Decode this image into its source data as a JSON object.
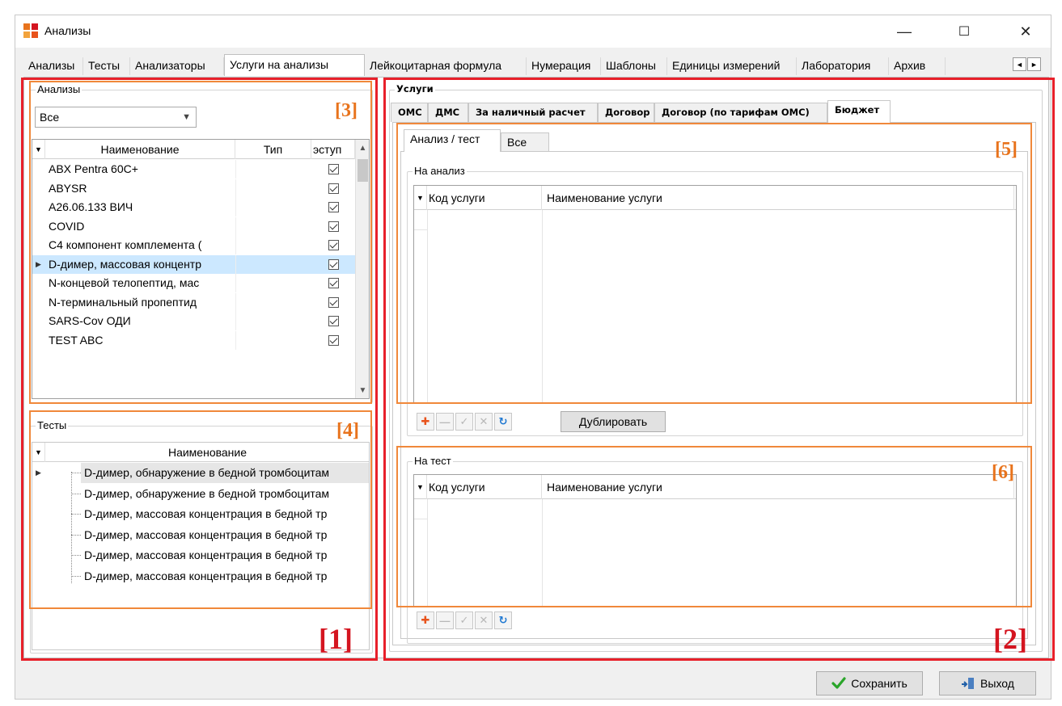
{
  "window": {
    "title": "Анализы",
    "minimize": "—",
    "maximize": "☐",
    "close": "✕"
  },
  "main_tabs": [
    {
      "label": "Анализы",
      "active": false
    },
    {
      "label": "Тесты",
      "active": false
    },
    {
      "label": "Анализаторы",
      "active": false
    },
    {
      "label": "Услуги на анализы",
      "active": true
    },
    {
      "label": "Лейкоцитарная формула",
      "active": false
    },
    {
      "label": "Нумерация",
      "active": false
    },
    {
      "label": "Шаблоны",
      "active": false
    },
    {
      "label": "Единицы измерений",
      "active": false
    },
    {
      "label": "Лаборатория",
      "active": false
    },
    {
      "label": "Архив",
      "active": false
    }
  ],
  "tab_scroll": {
    "left": "◄",
    "right": "►"
  },
  "analyses_panel": {
    "legend": "Анализы",
    "filter_value": "Все",
    "columns": [
      "Наименование",
      "Тип",
      "эступ"
    ],
    "rows": [
      {
        "name": "ABX Pentra 60C+",
        "type": "",
        "checked": true,
        "selected": false
      },
      {
        "name": "ABYSR",
        "type": "",
        "checked": true,
        "selected": false
      },
      {
        "name": "A26.06.133 ВИЧ",
        "type": "",
        "checked": true,
        "selected": false
      },
      {
        "name": "COVID",
        "type": "",
        "checked": true,
        "selected": false
      },
      {
        "name": "C4 компонент комплемента (",
        "type": "",
        "checked": true,
        "selected": false
      },
      {
        "name": "D-димер, массовая концентр",
        "type": "",
        "checked": true,
        "selected": true
      },
      {
        "name": "N-концевой телопептид, мас",
        "type": "",
        "checked": true,
        "selected": false
      },
      {
        "name": "N-терминальный пропептид",
        "type": "",
        "checked": true,
        "selected": false
      },
      {
        "name": "SARS-Cov ОДИ",
        "type": "",
        "checked": true,
        "selected": false
      },
      {
        "name": "TEST ABC",
        "type": "",
        "checked": true,
        "selected": false
      }
    ]
  },
  "tests_panel": {
    "legend": "Тесты",
    "column": "Наименование",
    "rows": [
      "D-димер, обнаружение в бедной тромбоцитам",
      "D-димер, обнаружение в бедной тромбоцитам",
      "D-димер, массовая концентрация в бедной тр",
      "D-димер, массовая концентрация в бедной тр",
      "D-димер, массовая концентрация в бедной тр",
      "D-димер, массовая концентрация в бедной тр"
    ]
  },
  "services_panel": {
    "legend": "Услуги",
    "payment_tabs": [
      {
        "label": "ОМС",
        "active": false
      },
      {
        "label": "ДМС",
        "active": false
      },
      {
        "label": "За наличный расчет",
        "active": false
      },
      {
        "label": "Договор",
        "active": false
      },
      {
        "label": "Договор (по тарифам ОМС)",
        "active": false
      },
      {
        "label": "Бюджет",
        "active": true
      }
    ],
    "inner_tabs": [
      {
        "label": "Анализ / тест",
        "active": true
      },
      {
        "label": "Все",
        "active": false
      }
    ],
    "on_analysis": {
      "legend": "На анализ",
      "columns": [
        "Код услуги",
        "Наименование услуги"
      ],
      "duplicate_button": "Дублировать"
    },
    "on_test": {
      "legend": "На тест",
      "columns": [
        "Код услуги",
        "Наименование услуги"
      ]
    }
  },
  "toolbar_icons": {
    "add": "✚",
    "remove": "—",
    "apply": "✓",
    "cancel": "✕",
    "refresh": "↻"
  },
  "footer": {
    "save_label": "Сохранить",
    "exit_label": "Выход"
  },
  "annotations": {
    "m1": "[1]",
    "m2": "[2]",
    "m3": "[3]",
    "m4": "[4]",
    "m5": "[5]",
    "m6": "[6]"
  },
  "colors": {
    "red_frame": "#e8202a",
    "orange_frame": "#f0883a",
    "selection": "#cce8ff",
    "save_check": "#2aa52a",
    "refresh_blue": "#1f78d1",
    "add_orange": "#e8531c"
  }
}
